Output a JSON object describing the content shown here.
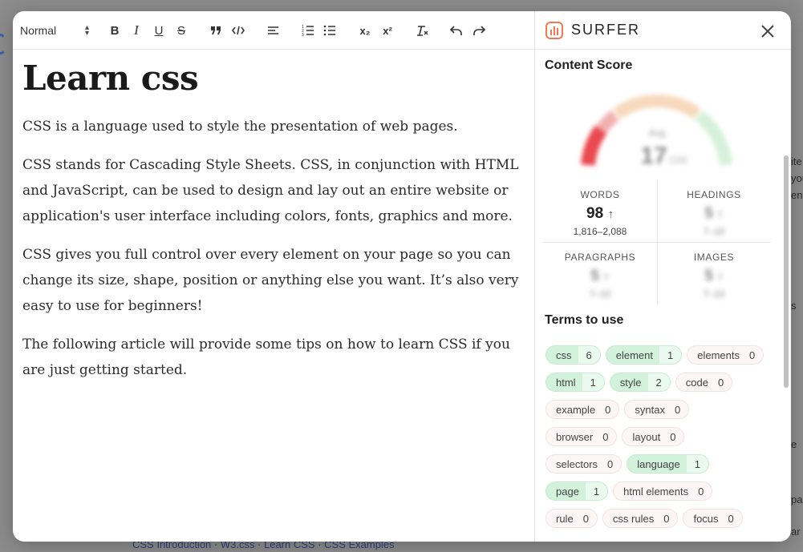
{
  "toolbar": {
    "format_select": "Normal",
    "icons": [
      "bold-icon",
      "italic-icon",
      "underline-icon",
      "strikethrough-icon",
      "blockquote-icon",
      "code-icon",
      "align-left-icon",
      "ordered-list-icon",
      "bullet-list-icon",
      "subscript-icon",
      "superscript-icon",
      "clear-format-icon",
      "undo-icon",
      "redo-icon"
    ],
    "bold": "B",
    "italic": "I",
    "underline": "U",
    "strike": "S",
    "subscript": "x₂",
    "superscript": "x²"
  },
  "document": {
    "title": "Learn css",
    "paragraphs": [
      "CSS is a language used to style the presentation of web pages.",
      "CSS stands for Cascading Style Sheets. CSS, in conjunction with HTML and JavaScript, can be used to design and lay out an entire website or application's user interface including colors, fonts, graphics and more.",
      "CSS gives you full control over every element on your page so you can change its size, shape, position or anything else you want. It’s also very easy to use for beginners!",
      "The following article will provide some tips on how to learn CSS if you are just getting started."
    ]
  },
  "surfer": {
    "brand": "SURFER",
    "content_score_title": "Content Score",
    "score_value": "17",
    "score_suffix": "/100",
    "score_label": "Avg",
    "stats": {
      "words": {
        "label": "WORDS",
        "value": "98",
        "trend": "↑",
        "range": "1,816–2,088"
      },
      "headings": {
        "label": "HEADINGS",
        "value": "5",
        "trend": "↑",
        "range": "7–10"
      },
      "paragraphs": {
        "label": "PARAGRAPHS",
        "value": "5",
        "trend": "↑",
        "range": "7–10"
      },
      "images": {
        "label": "IMAGES",
        "value": "5",
        "trend": "↑",
        "range": "7–10"
      }
    },
    "terms_title": "Terms to use",
    "terms": [
      [
        {
          "term": "css",
          "count": "6",
          "done": true
        },
        {
          "term": "element",
          "count": "1",
          "done": true
        },
        {
          "term": "elements",
          "count": "0",
          "done": false
        }
      ],
      [
        {
          "term": "html",
          "count": "1",
          "done": true
        },
        {
          "term": "style",
          "count": "2",
          "done": true
        },
        {
          "term": "code",
          "count": "0",
          "done": false
        }
      ],
      [
        {
          "term": "example",
          "count": "0",
          "done": false
        },
        {
          "term": "syntax",
          "count": "0",
          "done": false
        }
      ],
      [
        {
          "term": "browser",
          "count": "0",
          "done": false
        },
        {
          "term": "layout",
          "count": "0",
          "done": false
        }
      ],
      [
        {
          "term": "selectors",
          "count": "0",
          "done": false
        },
        {
          "term": "language",
          "count": "1",
          "done": true
        }
      ],
      [
        {
          "term": "page",
          "count": "1",
          "done": true
        },
        {
          "term": "html elements",
          "count": "0",
          "done": false
        }
      ],
      [
        {
          "term": "rule",
          "count": "0",
          "done": false
        },
        {
          "term": "css rules",
          "count": "0",
          "done": false
        },
        {
          "term": "focus",
          "count": "0",
          "done": false
        }
      ]
    ]
  },
  "background": {
    "bottom_links": "CSS Introduction · W3.css · Learn CSS · CSS Examples",
    "right_fragments": [
      "ite",
      "you",
      "ent",
      "s",
      "e",
      "pag",
      "ar"
    ]
  },
  "colors": {
    "done_chip": "#d2f2db",
    "todo_chip": "#fdf6f6",
    "gauge_red": "#e9494f",
    "gauge_orange": "#f6c49a",
    "gauge_green": "#bfe9c6"
  }
}
